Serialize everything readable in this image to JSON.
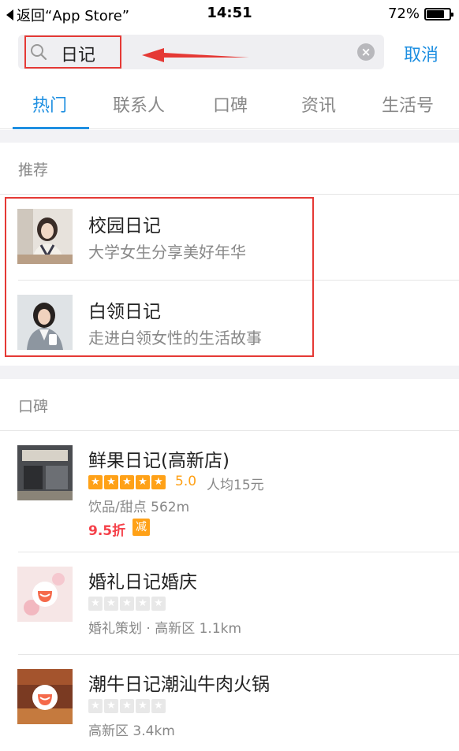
{
  "status_bar": {
    "back_label": "返回“App Store”",
    "time": "14:51",
    "battery": "72%"
  },
  "search": {
    "query": "日记",
    "cancel_label": "取消"
  },
  "tabs": [
    {
      "label": "热门",
      "active": true
    },
    {
      "label": "联系人",
      "active": false
    },
    {
      "label": "口碑",
      "active": false
    },
    {
      "label": "资讯",
      "active": false
    },
    {
      "label": "生活号",
      "active": false
    }
  ],
  "recommend": {
    "heading": "推荐",
    "items": [
      {
        "title": "校园日记",
        "subtitle": "大学女生分享美好年华"
      },
      {
        "title": "白领日记",
        "subtitle": "走进白领女性的生活故事"
      }
    ]
  },
  "koubei": {
    "heading": "口碑",
    "items": [
      {
        "name": "鲜果日记(高新店)",
        "stars": 5,
        "rating": "5.0",
        "avg_price": "人均15元",
        "meta": "饮品/甜点 562m",
        "discount": "9.5折",
        "badge": "减"
      },
      {
        "name": "婚礼日记婚庆",
        "stars": 0,
        "meta": "婚礼策划 · 高新区 1.1km"
      },
      {
        "name": "潮牛日记潮汕牛肉火锅",
        "stars": 0,
        "meta": "高新区 3.4km"
      }
    ]
  },
  "colors": {
    "accent": "#1e8fe1",
    "star": "#ffa117",
    "discount": "#f5414a",
    "annotation": "#e53935"
  }
}
